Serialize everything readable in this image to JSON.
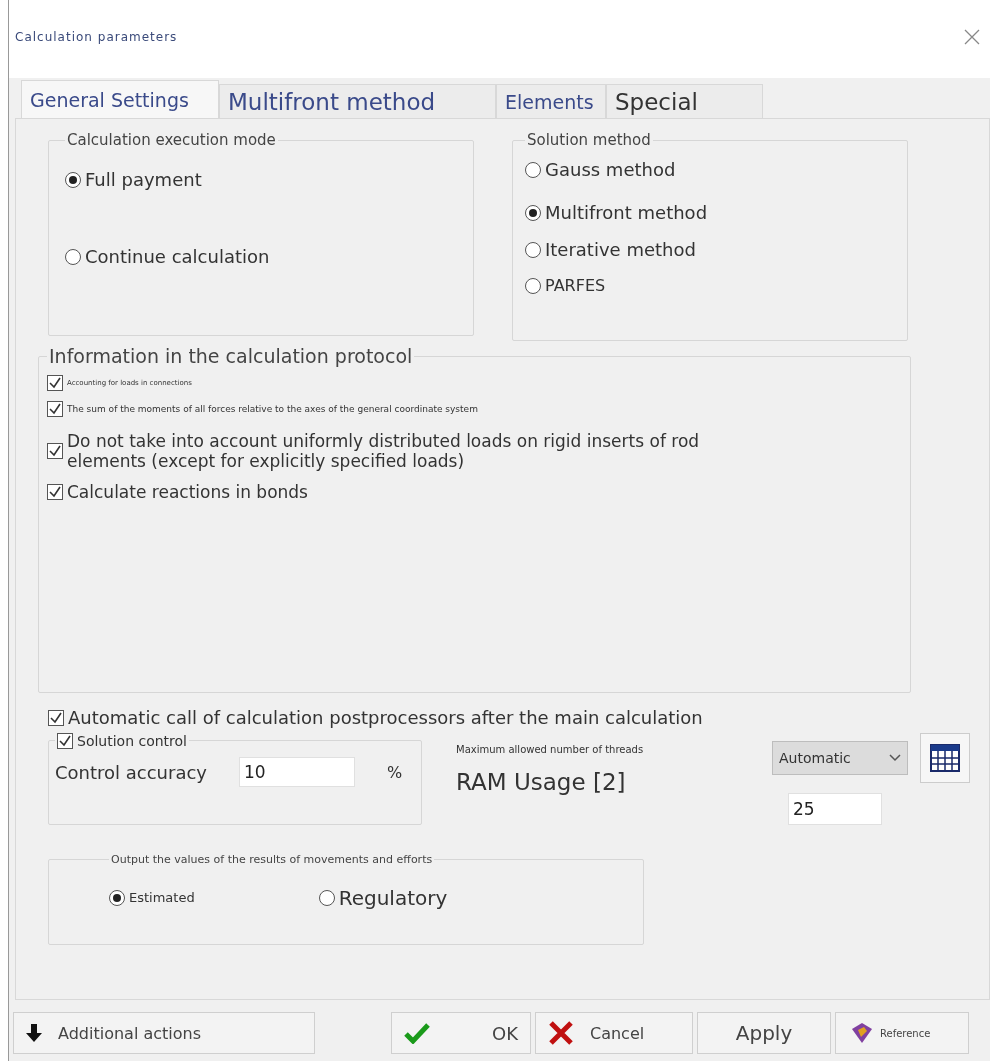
{
  "window": {
    "title": "Calculation parameters"
  },
  "tabs": [
    {
      "label": "General Settings",
      "selected": true
    },
    {
      "label": "Multifront method",
      "selected": false
    },
    {
      "label": "Elements",
      "selected": false
    },
    {
      "label": "Special",
      "selected": false
    }
  ],
  "execution_mode": {
    "title": "Calculation execution mode",
    "options": [
      {
        "label": "Full payment",
        "selected": true
      },
      {
        "label": "Continue calculation",
        "selected": false
      }
    ]
  },
  "solution_method": {
    "title": "Solution method",
    "options": [
      {
        "label": "Gauss method",
        "selected": false
      },
      {
        "label": "Multifront method",
        "selected": true
      },
      {
        "label": "Iterative method",
        "selected": false
      },
      {
        "label": "PARFES",
        "selected": false
      }
    ]
  },
  "protocol": {
    "title": "Information in the calculation protocol",
    "items": [
      {
        "label": "Accounting for loads in connections",
        "checked": true
      },
      {
        "label": "The sum of the moments of all forces relative to the axes of the general coordinate system",
        "checked": true
      },
      {
        "label": "Do not take into account uniformly distributed loads on rigid inserts of rod elements (except for explicitly specified loads)",
        "checked": true
      },
      {
        "label": "Calculate reactions in bonds",
        "checked": true
      }
    ]
  },
  "postprocessors": {
    "label": "Automatic call of calculation postprocessors after the main calculation",
    "checked": true
  },
  "solution_control": {
    "label": "Solution control",
    "checked": true,
    "accuracy_label": "Control accuracy",
    "accuracy_value": "10",
    "unit": "%"
  },
  "threads": {
    "label": "Maximum allowed number of threads",
    "value": "Automatic"
  },
  "ram": {
    "label": "RAM Usage [2]",
    "value": "25"
  },
  "output": {
    "title": "Output the values of the results of movements and efforts",
    "options": [
      {
        "label": "Estimated",
        "selected": true
      },
      {
        "label": "Regulatory",
        "selected": false
      }
    ]
  },
  "buttons": [
    {
      "label": "Additional actions",
      "kind": "additional"
    },
    {
      "label": "OK",
      "kind": "ok"
    },
    {
      "label": "Cancel",
      "kind": "cancel"
    },
    {
      "label": "Apply",
      "kind": "apply"
    },
    {
      "label": "Reference",
      "kind": "reference"
    }
  ]
}
